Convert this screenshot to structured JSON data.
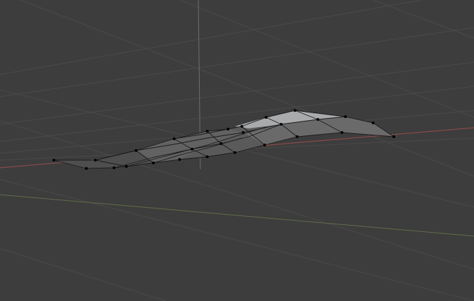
{
  "viewport": {
    "background_color": "#3d3d3d",
    "grid_color": "#4a4a4a",
    "grid_major_color": "#555555",
    "x_axis_color": "#8a4a4a",
    "y_axis_color": "#5f6e4a",
    "z_axis_color": "#6f6f6f",
    "mesh_edge_color": "#1a1a1a",
    "mesh_vertex_color": "#000000",
    "mesh_face_color": "#595959",
    "mesh_highlight_color": "#a9aaac",
    "view_mode": "edit-mode-wireframe-overlay",
    "object_icon": "mesh-object-icon"
  }
}
